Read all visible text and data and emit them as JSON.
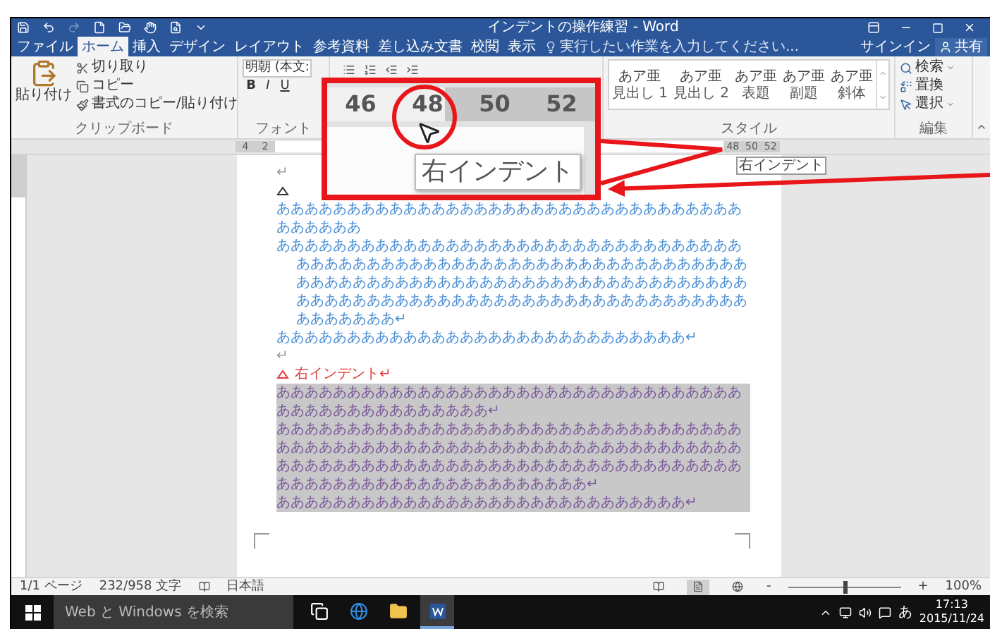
{
  "window": {
    "title": "インデントの操作練習 - Word"
  },
  "quick_access": [
    {
      "kind": "save",
      "disabled": false
    },
    {
      "kind": "undo",
      "disabled": false
    },
    {
      "kind": "redo",
      "disabled": true
    },
    {
      "kind": "new",
      "disabled": false
    },
    {
      "kind": "open",
      "disabled": false
    },
    {
      "kind": "touch",
      "disabled": false
    },
    {
      "kind": "preview",
      "disabled": false
    },
    {
      "kind": "customize",
      "disabled": false
    }
  ],
  "tabs": [
    {
      "label": "ファイル",
      "selected": false
    },
    {
      "label": "ホーム",
      "selected": true
    },
    {
      "label": "挿入",
      "selected": false
    },
    {
      "label": "デザイン",
      "selected": false
    },
    {
      "label": "レイアウト",
      "selected": false
    },
    {
      "label": "参考資料",
      "selected": false
    },
    {
      "label": "差し込み文書",
      "selected": false
    },
    {
      "label": "校閲",
      "selected": false
    },
    {
      "label": "表示",
      "selected": false
    }
  ],
  "tell_me": {
    "placeholder": "実行したい作業を入力してください..."
  },
  "account": {
    "sign_in": "サインイン",
    "share": "共有"
  },
  "clipboard": {
    "paste": "貼り付け",
    "items": [
      {
        "kind": "cut",
        "label": "切り取り"
      },
      {
        "kind": "copy",
        "label": "コピー"
      },
      {
        "kind": "format",
        "label": "書式のコピー/貼り付け"
      }
    ],
    "label": "クリップボード"
  },
  "font": {
    "font_name": "明朝 (本文:",
    "buttons": [
      "B",
      "I",
      "U"
    ],
    "label": "フォント"
  },
  "styles": {
    "items": [
      {
        "sample": "あア亜",
        "name": "見出し 1"
      },
      {
        "sample": "あア亜",
        "name": "見出し 2"
      },
      {
        "sample": "あア亜",
        "name": "表題"
      },
      {
        "sample": "あア亜",
        "name": "副題"
      },
      {
        "sample": "あア亜",
        "name": "斜体"
      }
    ],
    "label": "スタイル"
  },
  "editing": {
    "items": [
      {
        "kind": "find",
        "label": "検索",
        "dropdown": true
      },
      {
        "kind": "replace",
        "label": "置換",
        "dropdown": false
      },
      {
        "kind": "select",
        "label": "選択",
        "dropdown": true
      }
    ],
    "label": "編集"
  },
  "ruler": {
    "left_numbers": [
      "4",
      "2"
    ],
    "right_numbers": [
      "48",
      "50",
      "52"
    ],
    "tooltip": "右インデント"
  },
  "document": [
    {
      "kind": "blank",
      "text": "↵"
    },
    {
      "kind": "heading",
      "color": "#333333"
    },
    {
      "kind": "para",
      "text": "あああああああああああああああああああああああああああああああああああああああ",
      "color": "#4a8fd6",
      "hanging": false,
      "highlighted": false
    },
    {
      "kind": "para",
      "text": "ああああああああああああああああああああああああああああああああああああああああああああああああああああああああああああああああああああああああああああああああああああああああああああああああああああああああああああああああああああああああああああああああああああああああ↵",
      "color": "#4a8fd6",
      "hanging": true,
      "highlighted": false
    },
    {
      "kind": "para",
      "text": "あああああああああああああああああああああああああああああ↵",
      "color": "#4a8fd6",
      "highlighted": false
    },
    {
      "kind": "blank",
      "text": "↵"
    },
    {
      "kind": "heading",
      "text": "右インデント↵",
      "color": "#e53935"
    },
    {
      "kind": "para",
      "text": "ああああああああああああああああああああああああああああああああああああああああああああああああ↵",
      "color": "#7b5a9c",
      "hanging": false,
      "highlighted": true
    },
    {
      "kind": "para",
      "text": "あああああああああああああああああああああああああああああああああああああああああああああああああああああああああああああああああああああああああああああああああああああああああああああああああああああああああああああああああああああああああ↵",
      "color": "#7b5a9c",
      "hanging": false,
      "highlighted": true
    },
    {
      "kind": "para",
      "text": "あああああああああああああああああああああああああああああ↵",
      "color": "#7b5a9c",
      "hanging": false,
      "highlighted": true
    }
  ],
  "callout": {
    "ruler_numbers": [
      "46",
      "48",
      "50",
      "52"
    ],
    "tooltip": "右インデント"
  },
  "status_bar": {
    "page": "1/1 ページ",
    "words": "232/958 文字",
    "language": "日本語",
    "views": [
      {
        "kind": "read",
        "selected": false
      },
      {
        "kind": "print",
        "selected": true
      },
      {
        "kind": "web",
        "selected": false
      }
    ],
    "zoom": {
      "minus": "-",
      "plus": "+",
      "level": 0.5,
      "reading": "100%"
    }
  },
  "taskbar": {
    "search": {
      "placeholder": "Web と Windows を検索"
    },
    "apps": [
      {
        "kind": "taskview",
        "active": false
      },
      {
        "kind": "edge",
        "active": false
      },
      {
        "kind": "explorer",
        "active": false
      },
      {
        "kind": "word",
        "active": true
      }
    ],
    "ime": "あ",
    "time": "17:13",
    "date": "2015/11/24"
  }
}
